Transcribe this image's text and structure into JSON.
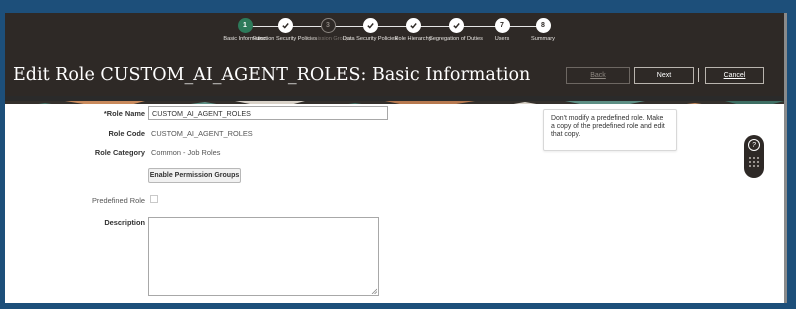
{
  "train": {
    "steps": [
      {
        "number": "1",
        "label": "Basic Information",
        "state": "current"
      },
      {
        "number": "2",
        "label": "Function Security Policies",
        "state": "done"
      },
      {
        "number": "3",
        "label": "Permission Groups",
        "state": "disabled"
      },
      {
        "number": "4",
        "label": "Data Security Policies",
        "state": "done"
      },
      {
        "number": "5",
        "label": "Role Hierarchy",
        "state": "done"
      },
      {
        "number": "6",
        "label": "Segregation of Duties",
        "state": "done"
      },
      {
        "number": "7",
        "label": "Users",
        "state": "numbered"
      },
      {
        "number": "8",
        "label": "Summary",
        "state": "numbered"
      }
    ]
  },
  "header": {
    "title": "Edit Role CUSTOM_AI_AGENT_ROLES: Basic Information",
    "back_label": "Back",
    "next_label": "Next",
    "cancel_label": "Cancel"
  },
  "form": {
    "role_name_label": "*Role Name",
    "role_name_value": "CUSTOM_AI_AGENT_ROLES",
    "role_code_label": "Role Code",
    "role_code_value": "CUSTOM_AI_AGENT_ROLES",
    "role_category_label": "Role Category",
    "role_category_value": "Common - Job Roles",
    "enable_permission_groups_label": "Enable Permission Groups",
    "predefined_role_label": "Predefined Role",
    "predefined_role_checked": false,
    "description_label": "Description",
    "description_value": ""
  },
  "note": {
    "text": "Don't modify a predefined role. Make a copy of the predefined role and edit that copy."
  },
  "colors": {
    "header_bg": "#2e2926",
    "current_step": "#2d7a5a",
    "outer_border": "#1d4f7a"
  },
  "icons": {
    "done_step": "checkmark-icon",
    "help_widget": "help-icon",
    "grid_widget": "apps-grid-icon"
  }
}
